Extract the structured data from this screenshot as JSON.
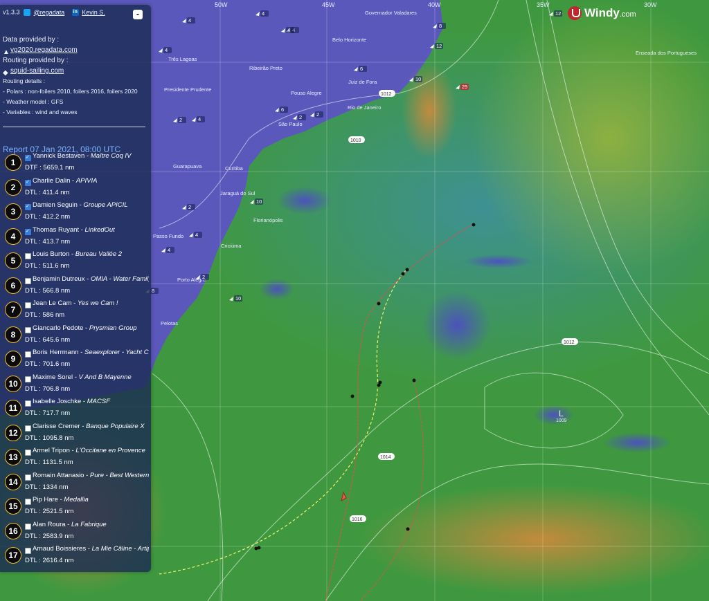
{
  "map": {
    "meridians": [
      "50W",
      "45W",
      "40W",
      "35W",
      "30W"
    ],
    "places": [
      {
        "name": "Belo Horizonte"
      },
      {
        "name": "Três Lagoas"
      },
      {
        "name": "Ribeirão Preto"
      },
      {
        "name": "Pouso Alegre"
      },
      {
        "name": "Juiz de Fora"
      },
      {
        "name": "Rio de Janeiro"
      },
      {
        "name": "São Paulo"
      },
      {
        "name": "Guarapuava"
      },
      {
        "name": "Curitiba"
      },
      {
        "name": "Jaraguá do Sul"
      },
      {
        "name": "Florianópolis"
      },
      {
        "name": "Passo Fundo"
      },
      {
        "name": "Criciúma"
      },
      {
        "name": "Porto Alegre"
      },
      {
        "name": "Pelotas"
      },
      {
        "name": "Enseada dos Portugueses"
      },
      {
        "name": "Presidente Prudente"
      },
      {
        "name": "Governador Valadares"
      }
    ],
    "isobars": [
      "1010",
      "1012",
      "1012",
      "1014",
      "1016",
      "1009"
    ],
    "low_label": "L",
    "wind_arrows": [
      "4",
      "4",
      "4",
      "2",
      "2",
      "6",
      "10",
      "12",
      "8",
      "12",
      "4",
      "4",
      "2",
      "4",
      "6",
      "2",
      "10",
      "4",
      "8",
      "10",
      "2",
      "4",
      "29"
    ]
  },
  "panel": {
    "version": "v1.3.3",
    "twitter": "@regadata",
    "linkedin_label": "in",
    "linkedin": "Kevin S.",
    "collapse_label": "-",
    "data_title": "Data provided by :",
    "data_link": "vg2020.regadata.com",
    "routing_title": "Routing provided by :",
    "routing_link": "squid-sailing.com",
    "details_title": "Routing details :",
    "details": [
      "- Polars : non-foilers 2010, foilers 2016, foilers 2020",
      "- Weather model : GFS",
      "- Variables : wind and waves"
    ],
    "report": "Report 07 Jan 2021, 08:00 UTC",
    "skippers": [
      {
        "rank": "1",
        "name": "Yannick Bestaven",
        "boat": "Maître Coq IV",
        "dist": "DTF : 5659.1 nm",
        "checked": true
      },
      {
        "rank": "2",
        "name": "Charlie Dalin",
        "boat": "APIVIA",
        "dist": "DTL : 411.4 nm",
        "checked": true
      },
      {
        "rank": "3",
        "name": "Damien Seguin",
        "boat": "Groupe APICIL",
        "dist": "DTL : 412.2 nm",
        "checked": true
      },
      {
        "rank": "4",
        "name": "Thomas Ruyant",
        "boat": "LinkedOut",
        "dist": "DTL : 413.7 nm",
        "checked": true
      },
      {
        "rank": "5",
        "name": "Louis Burton",
        "boat": "Bureau Vallée 2",
        "dist": "DTL : 511.6 nm",
        "checked": false
      },
      {
        "rank": "6",
        "name": "Benjamin Dutreux",
        "boat": "OMIA - Water Family",
        "dist": "DTL : 566.8 nm",
        "checked": false
      },
      {
        "rank": "7",
        "name": "Jean Le Cam",
        "boat": "Yes we Cam !",
        "dist": "DTL : 586 nm",
        "checked": false
      },
      {
        "rank": "8",
        "name": "Giancarlo Pedote",
        "boat": "Prysmian Group",
        "dist": "DTL : 645.6 nm",
        "checked": false
      },
      {
        "rank": "9",
        "name": "Boris Herrmann",
        "boat": "Seaexplorer - Yacht Club de Monaco",
        "dist": "DTL : 701.6 nm",
        "checked": false
      },
      {
        "rank": "10",
        "name": "Maxime Sorel",
        "boat": "V And B Mayenne",
        "dist": "DTL : 706.8 nm",
        "checked": false
      },
      {
        "rank": "11",
        "name": "Isabelle Joschke",
        "boat": "MACSF",
        "dist": "DTL : 717.7 nm",
        "checked": false
      },
      {
        "rank": "12",
        "name": "Clarisse Cremer",
        "boat": "Banque Populaire X",
        "dist": "DTL : 1095.8 nm",
        "checked": false
      },
      {
        "rank": "13",
        "name": "Armel Tripon",
        "boat": "L'Occitane en Provence",
        "dist": "DTL : 1131.5 nm",
        "checked": false
      },
      {
        "rank": "14",
        "name": "Romain Attanasio",
        "boat": "Pure - Best Western",
        "dist": "DTL : 1334 nm",
        "checked": false
      },
      {
        "rank": "15",
        "name": "Pip Hare",
        "boat": "Medallia",
        "dist": "DTL : 2521.5 nm",
        "checked": false
      },
      {
        "rank": "16",
        "name": "Alan Roura",
        "boat": "La Fabrique",
        "dist": "DTL : 2583.9 nm",
        "checked": false
      },
      {
        "rank": "17",
        "name": "Arnaud Boissieres",
        "boat": "La Mie Câline - Artipôle",
        "dist": "DTL : 2616.4 nm",
        "checked": false
      }
    ]
  },
  "windy": {
    "brand": "Windy",
    "suffix": ".com"
  },
  "colors": {
    "land": "#5a55b8",
    "ocean_green": "#3f9a3e",
    "warm": "#c38a3a",
    "accent": "#f6c02b",
    "report": "#7fb3ff"
  }
}
